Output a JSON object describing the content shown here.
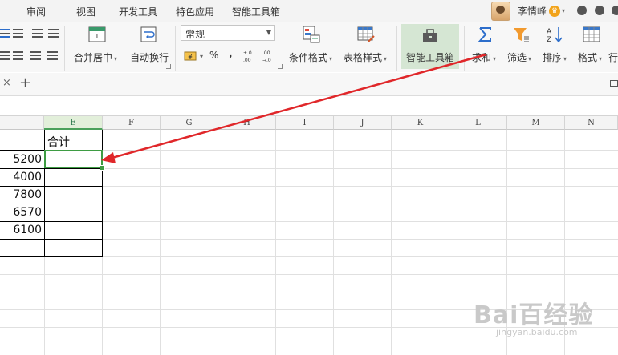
{
  "menu": {
    "items": [
      "审阅",
      "视图",
      "开发工具",
      "特色应用",
      "智能工具箱"
    ]
  },
  "user": {
    "name": "李情峰"
  },
  "ribbon": {
    "merge_center": "合并居中",
    "wrap_text": "自动换行",
    "number_format": "常规",
    "percent": "%",
    "comma": ",",
    "conditional_format": "条件格式",
    "table_style": "表格样式",
    "smart_toolbox": "智能工具箱",
    "sum": "求和",
    "filter": "筛选",
    "sort": "排序",
    "format": "格式",
    "rows": "行"
  },
  "tabs": {
    "new_tab": "+"
  },
  "columns": [
    "E",
    "F",
    "G",
    "H",
    "I",
    "J",
    "K",
    "L",
    "M",
    "N"
  ],
  "sheet": {
    "header_total": "合计",
    "values": [
      "5200",
      "4000",
      "7800",
      "6570",
      "6100"
    ]
  },
  "watermark": {
    "brand": "Bai百经验",
    "url": "jingyan.baidu.com"
  },
  "colors": {
    "accent_green": "#3e9c43",
    "arrow_red": "#e0272a"
  }
}
